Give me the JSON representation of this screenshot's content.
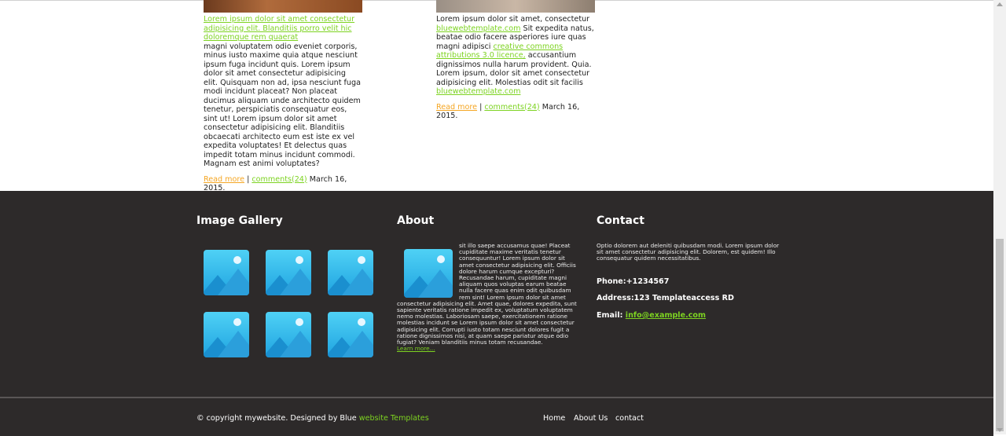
{
  "posts": [
    {
      "link_text": "Lorem ipsum dolor sit amet consectetur adipisicing elit. Blanditiis porro velit hic doloremque rem quaerat",
      "body": "magni voluptatem odio eveniet corporis, minus iusto maxime quia atque nesciunt ipsum fuga incidunt quis. Lorem ipsum dolor sit amet consectetur adipisicing elit. Quisquam non ad, ipsa nesciunt fuga modi incidunt placeat? Non placeat ducimus aliquam unde architecto quidem tenetur, perspiciatis consequatur eos, sint ut! Lorem ipsum dolor sit amet consectetur adipisicing elit. Blanditiis obcaecati architecto eum est iste ex vel expedita voluptates! Et delectus quas impedit totam minus incidunt commodi. Magnam est animi voluptates?",
      "read_more": "Read more",
      "separator": "|",
      "comments": "comments(24)",
      "date": "March 16, 2015."
    },
    {
      "text1": "Lorem ipsum dolor sit amet, consectetur",
      "link1": "bluewebtemplate.com",
      "text2": "Sit expedita natus, beatae odio facere asperiores iure quas magni adipisci",
      "link2": "creative commons attributions 3.0 licence,",
      "text3": "accusantium dignissimos nulla harum provident. Quia. Lorem ipsum, dolor sit amet consectetur adipisicing elit. Molestias odit sit facilis",
      "link3": "bluewebtemplate.com",
      "read_more": "Read more",
      "separator": "|",
      "comments": "comments(24)",
      "date": "March 16, 2015."
    }
  ],
  "footer": {
    "gallery_title": "Image Gallery",
    "about_title": "About",
    "about_text": "sit illo saepe accusamus quae! Placeat cupiditate maxime veritatis tenetur consequuntur! Lorem ipsum dolor sit amet consectetur adipisicing elit. Officiis dolore harum cumque excepturi? Recusandae harum, cupiditate magni aliquam quos voluptas earum beatae nulla facere quas enim odit quibusdam rem sint! Lorem ipsum dolor sit amet consectetur adipisicing elit. Amet quae, dolores expedita, sunt sapiente veritatis ratione impedit ex, voluptatum voluptatem nemo molestias. Laboriosam saepe, exercitationem ratione molestias incidunt se Lorem ipsum dolor sit amet consectetur adipisicing elit. Corrupti iusto totam nesciunt dolores fugit a ratione dignissimos nisi, at quam saepe pariatur atque odio fugiat? Veniam blanditiis minus totam recusandae.",
    "about_link": "Learn more...",
    "contact_title": "Contact",
    "contact_text": "Optio dolorem aut deleniti quibusdam modi. Lorem ipsum dolor sit amet consectetur adipisicing elit. Dolorem, est quidem! Illo consequatur quidem necessitatibus.",
    "phone": "Phone:+1234567",
    "address": "Address:123 Templateaccess RD",
    "email_label": "Email:",
    "email": "info@example.com"
  },
  "bottom": {
    "copyright": "© copyright mywebsite. Designed by Blue",
    "brand": "website Templates",
    "nav": [
      "Home",
      "About Us",
      "contact"
    ]
  }
}
